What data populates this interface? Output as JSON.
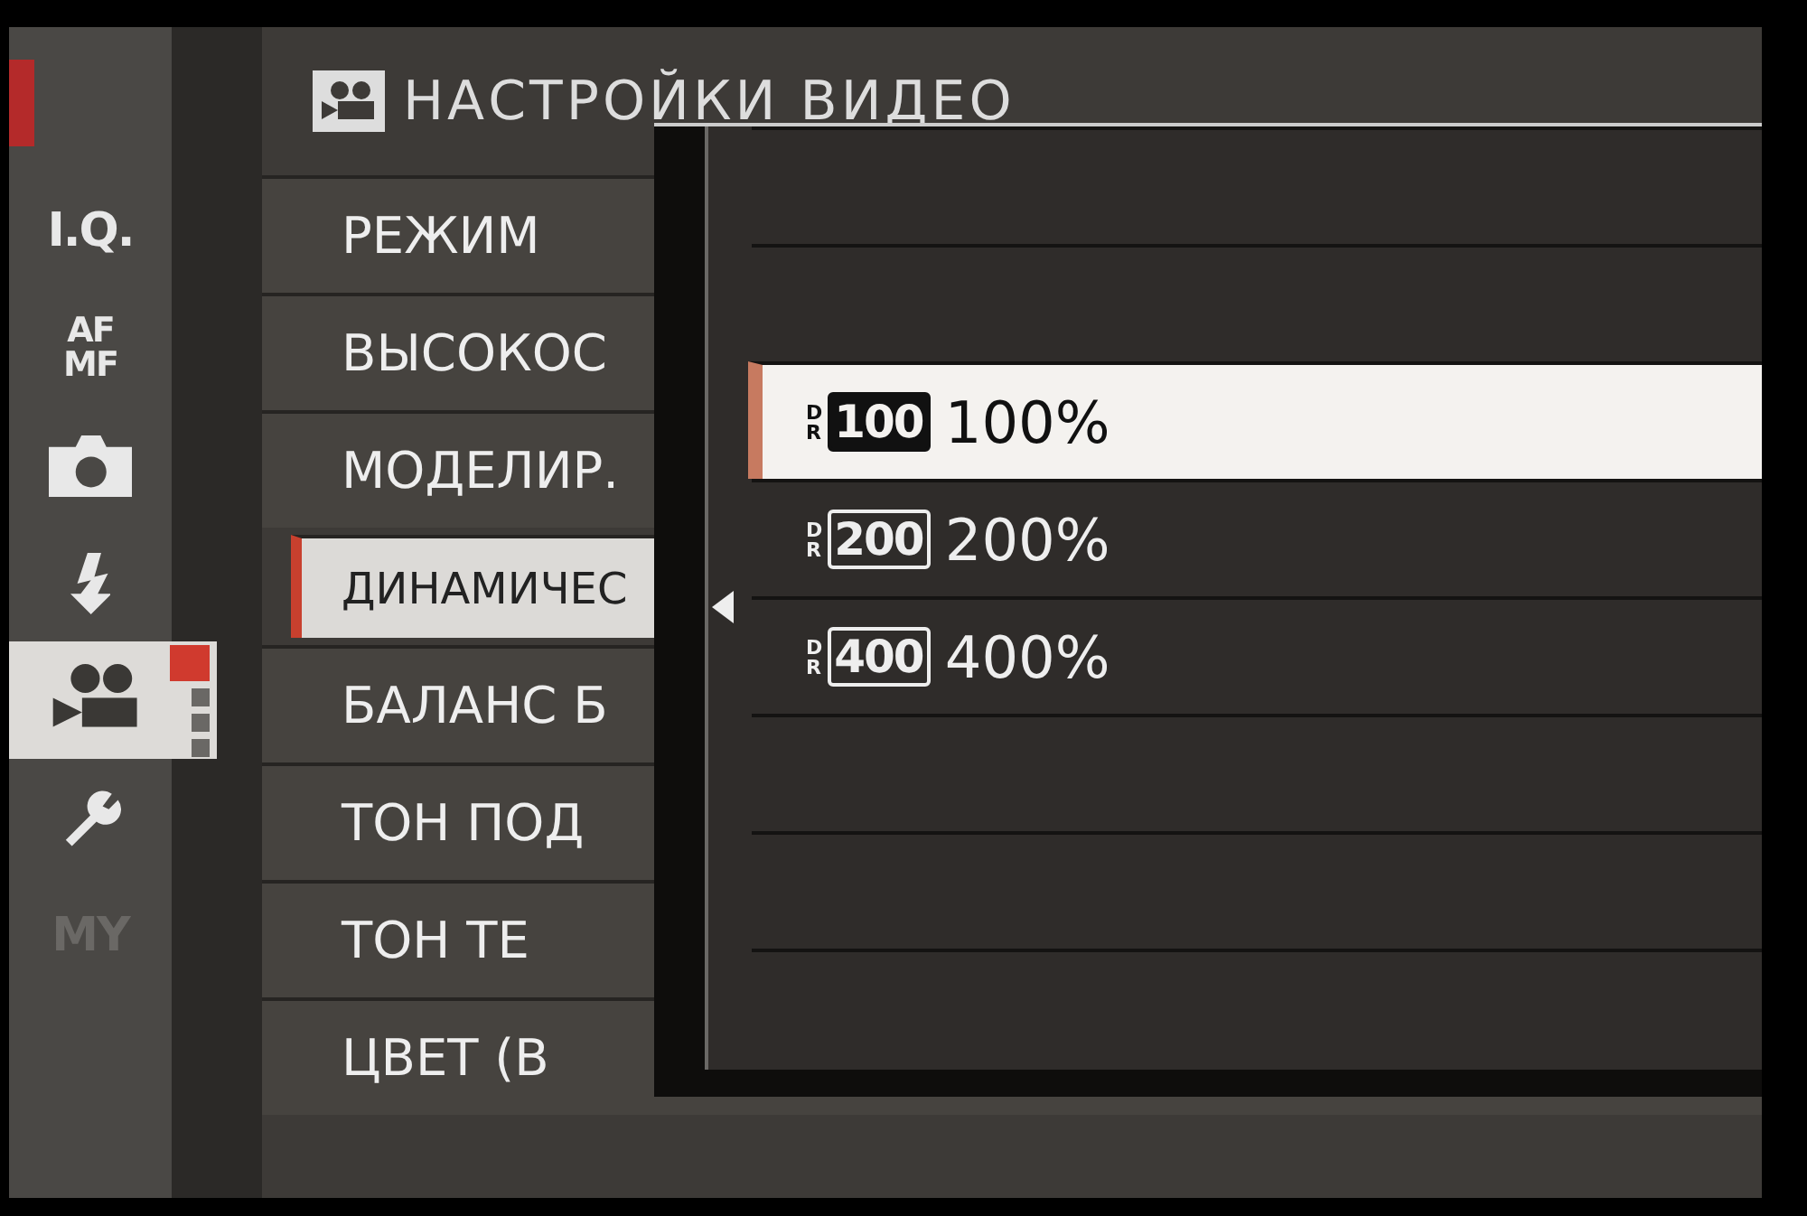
{
  "sidebar": {
    "tabs": [
      {
        "kind": "iq",
        "label": "I.Q.",
        "selected": false,
        "disabled": false
      },
      {
        "kind": "afmf",
        "label": "AF MF",
        "selected": false,
        "disabled": false
      },
      {
        "kind": "camera",
        "selected": false,
        "disabled": false
      },
      {
        "kind": "flash",
        "selected": false,
        "disabled": false
      },
      {
        "kind": "video",
        "selected": true,
        "disabled": false
      },
      {
        "kind": "wrench",
        "selected": false,
        "disabled": false
      },
      {
        "kind": "my",
        "label": "MY",
        "selected": false,
        "disabled": true
      }
    ]
  },
  "header": {
    "title": "НАСТРОЙКИ ВИДЕО"
  },
  "menu": {
    "items": [
      {
        "label": "РЕЖИМ",
        "selected": false
      },
      {
        "label": "ВЫСОКОС",
        "selected": false
      },
      {
        "label": "МОДЕЛИР.",
        "selected": false
      },
      {
        "label": "ДИНАМИЧЕС",
        "selected": true
      },
      {
        "label": "БАЛАНС Б",
        "selected": false
      },
      {
        "label": "ТОН ПОД",
        "selected": false
      },
      {
        "label": "ТОН ТЕ",
        "selected": false
      },
      {
        "label": "ЦВЕТ (В",
        "selected": false
      }
    ]
  },
  "popup": {
    "options": [
      {
        "dr": "DR",
        "badge": "100",
        "label": "100%",
        "selected": true
      },
      {
        "dr": "DR",
        "badge": "200",
        "label": "200%",
        "selected": false
      },
      {
        "dr": "DR",
        "badge": "400",
        "label": "400%",
        "selected": false
      }
    ]
  }
}
